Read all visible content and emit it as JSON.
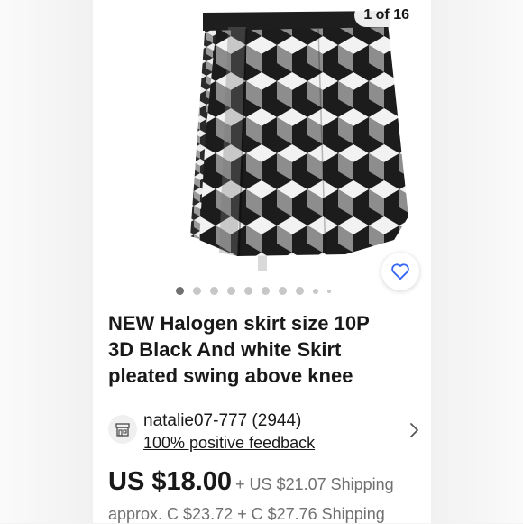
{
  "gallery": {
    "counter": "1 of 16",
    "dot_count": 10,
    "active_dot": 0
  },
  "listing": {
    "title_lines": [
      "NEW Halogen skirt size 10P",
      "3D Black And white Skirt",
      "pleated swing above knee"
    ]
  },
  "seller": {
    "name": "natalie07-777 (2944)",
    "feedback": "100% positive feedback"
  },
  "pricing": {
    "price": "US $18.00",
    "shipping": "+ US $21.07 Shipping",
    "approx": "approx. C $23.72 + C $27.76 Shipping"
  },
  "colors": {
    "accent": "#3665f3",
    "text": "#191919",
    "secondary": "#707070"
  },
  "icons": [
    "heart-icon",
    "store-icon",
    "chevron-right-icon"
  ]
}
